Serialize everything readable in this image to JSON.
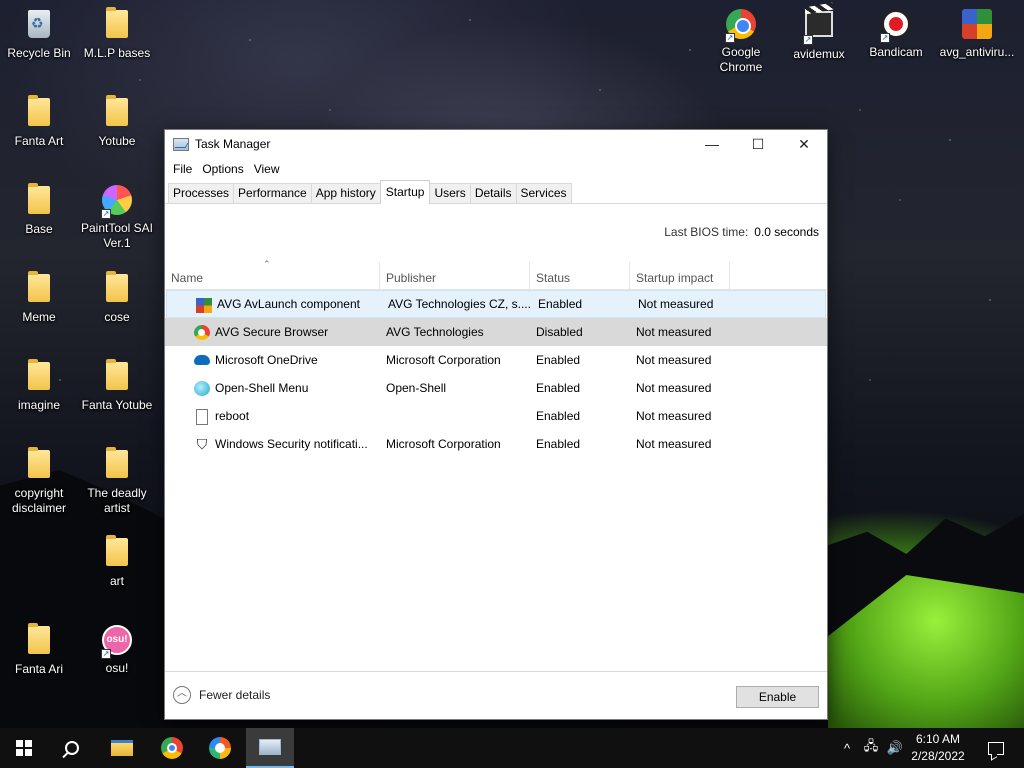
{
  "desktop": {
    "icons": [
      {
        "label": "Recycle Bin"
      },
      {
        "label": "M.L.P bases"
      },
      {
        "label": "Fanta Art"
      },
      {
        "label": "Yotube"
      },
      {
        "label": "Base"
      },
      {
        "label": "PaintTool SAI Ver.1"
      },
      {
        "label": "Meme"
      },
      {
        "label": "cose"
      },
      {
        "label": "imagine"
      },
      {
        "label": "Fanta Yotube"
      },
      {
        "label": "copyright disclaimer"
      },
      {
        "label": "The deadly artist"
      },
      {
        "label": "art"
      },
      {
        "label": "Fanta Ari"
      },
      {
        "label": "osu!",
        "glyph": "osu!"
      },
      {
        "label": "Google Chrome"
      },
      {
        "label": "avidemux"
      },
      {
        "label": "Bandicam"
      },
      {
        "label": "avg_antiviru..."
      }
    ]
  },
  "window": {
    "title": "Task Manager",
    "controls": {
      "minimize": "—",
      "maximize": "☐",
      "close": "✕"
    },
    "menu": [
      "File",
      "Options",
      "View"
    ],
    "tabs": [
      "Processes",
      "Performance",
      "App history",
      "Startup",
      "Users",
      "Details",
      "Services"
    ],
    "active_tab": "Startup",
    "bios": {
      "label": "Last BIOS time:",
      "value": "0.0 seconds"
    },
    "columns": {
      "name": "Name",
      "publisher": "Publisher",
      "status": "Status",
      "impact": "Startup impact"
    },
    "rows": [
      {
        "name": "AVG AvLaunch component",
        "publisher": "AVG Technologies CZ, s....",
        "status": "Enabled",
        "impact": "Not measured",
        "icon": "avg-icon"
      },
      {
        "name": "AVG Secure Browser",
        "publisher": "AVG Technologies",
        "status": "Disabled",
        "impact": "Not measured",
        "icon": "browser-icon"
      },
      {
        "name": "Microsoft OneDrive",
        "publisher": "Microsoft Corporation",
        "status": "Enabled",
        "impact": "Not measured",
        "icon": "cloud-icon"
      },
      {
        "name": "Open-Shell Menu",
        "publisher": "Open-Shell",
        "status": "Enabled",
        "impact": "Not measured",
        "icon": "shell-icon"
      },
      {
        "name": "reboot",
        "publisher": "",
        "status": "Enabled",
        "impact": "Not measured",
        "icon": "file-icon"
      },
      {
        "name": "Windows Security notificati...",
        "publisher": "Microsoft Corporation",
        "status": "Enabled",
        "impact": "Not measured",
        "icon": "shield-icon"
      }
    ],
    "footer": {
      "fewer_details": "Fewer details",
      "enable_button": "Enable"
    }
  },
  "taskbar": {
    "clock": {
      "time": "6:10 AM",
      "date": "2/28/2022"
    },
    "tray": {
      "chevron": "^",
      "network": "🖧",
      "volume": "🔊"
    }
  },
  "colors": {
    "accent": "#0078d7",
    "hover_row": "#e5f1fb",
    "selected_row": "#d9d9d9"
  }
}
